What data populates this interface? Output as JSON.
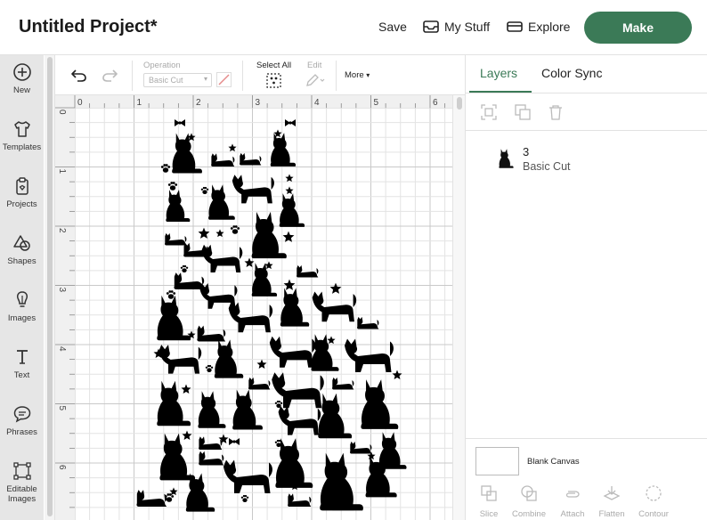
{
  "header": {
    "title": "Untitled Project*",
    "save_label": "Save",
    "my_stuff_label": "My Stuff",
    "explore_label": "Explore",
    "make_label": "Make"
  },
  "sidebar": {
    "items": [
      {
        "label": "New",
        "icon": "plus-circle-icon"
      },
      {
        "label": "Templates",
        "icon": "shirt-icon"
      },
      {
        "label": "Projects",
        "icon": "clipboard-icon"
      },
      {
        "label": "Shapes",
        "icon": "shapes-icon"
      },
      {
        "label": "Images",
        "icon": "lightbulb-icon"
      },
      {
        "label": "Text",
        "icon": "text-icon"
      },
      {
        "label": "Phrases",
        "icon": "speech-bubble-icon"
      },
      {
        "label": "Editable Images",
        "icon": "editable-images-icon"
      }
    ]
  },
  "toolbar": {
    "operation_label": "Operation",
    "operation_value": "Basic Cut",
    "select_all_label": "Select All",
    "edit_label": "Edit",
    "more_label": "More"
  },
  "ruler": {
    "top_ticks": [
      "0",
      "1",
      "2",
      "3",
      "4",
      "5",
      "6"
    ],
    "left_ticks": [
      "0",
      "1",
      "2",
      "3",
      "4",
      "5",
      "6"
    ]
  },
  "right_panel": {
    "tabs": [
      "Layers",
      "Color Sync"
    ],
    "active_tab": "Layers",
    "layers": [
      {
        "name": "3",
        "operation": "Basic Cut"
      }
    ],
    "blank_canvas_label": "Blank Canvas",
    "bottom_tools": [
      "Slice",
      "Combine",
      "Attach",
      "Flatten",
      "Contour"
    ]
  },
  "colors": {
    "accent": "#3b7a57",
    "sidebar_bg": "#e6e6e6",
    "canvas_bg": "#f0f0f0",
    "artwork": "#000000"
  }
}
